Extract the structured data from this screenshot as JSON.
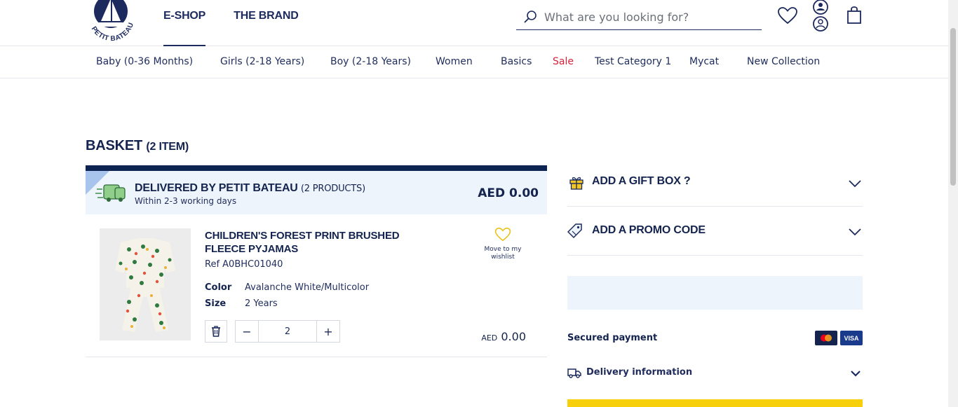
{
  "brand": {
    "logo_text": "PETIT BATEAU"
  },
  "main_nav": [
    "E-SHOP",
    "THE BRAND"
  ],
  "search": {
    "placeholder": "What are you looking for?"
  },
  "categories": [
    "Baby (0-36 Months)",
    "Girls (2-18 Years)",
    "Boy (2-18 Years)",
    "Women",
    "Basics",
    "Sale",
    "Test Category 1",
    "Mycat",
    "New Collection"
  ],
  "basket": {
    "title": "BASKET",
    "count": "(2 ITEM)",
    "delivery": {
      "title": "DELIVERED BY PETIT BATEAU",
      "products": "(2 PRODUCTS)",
      "days": "Within 2-3 working days",
      "price": "AED 0.00"
    },
    "item": {
      "name": "CHILDREN'S FOREST PRINT BRUSHED FLEECE PYJAMAS",
      "ref": "Ref A0BHC01040",
      "color_label": "Color",
      "color_value": "Avalanche White/Multicolor",
      "size_label": "Size",
      "size_value": "2 Years",
      "quantity": "2",
      "wishlist_label": "Move to my wishlist",
      "price_currency": "AED",
      "price_amount": "0.00"
    }
  },
  "sidebar": {
    "gift_box": "ADD A GIFT BOX ?",
    "promo_code": "ADD A PROMO CODE",
    "secured_payment": "Secured payment",
    "cards": [
      "mastercard",
      "VISA"
    ],
    "delivery_info": "Delivery information"
  },
  "colors": {
    "navy": "#14244f",
    "sale": "#d8213a",
    "accent_yellow": "#f7cf0b",
    "light_blue": "#eef4fb"
  }
}
